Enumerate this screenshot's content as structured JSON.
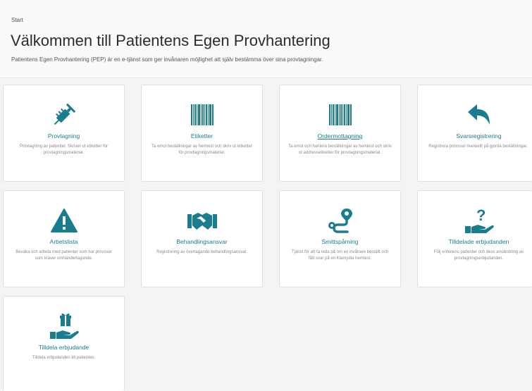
{
  "header": {
    "breadcrumb": "Start",
    "title": "Välkommen till Patientens Egen Provhantering",
    "subtitle": "Patientens Egen Provhantering (PEP) är en e-tjänst som ger invånaren möjlighet att själv bestämma över sina provtagningar."
  },
  "accent_color": "#1a7c8f",
  "cards": [
    {
      "title": "Provtagning",
      "icon": "syringe-icon",
      "desc": "Provtagning av patienter. Skriver ut etiketter för provtagningsmaterial."
    },
    {
      "title": "Etiketter",
      "icon": "barcode-icon",
      "desc": "Ta emot beställningar av hemtest och skriv ut etiketter för provtagningsmaterial."
    },
    {
      "title": "Ordermottagning",
      "icon": "barcode-icon",
      "desc": "Ta emot och hantera beställningar av hemtest och skriv ut addressetiketter för provtagningsmaterial."
    },
    {
      "title": "Svarsregistrering",
      "icon": "reply-arrow-icon",
      "desc": "Registrera provsvar manuellt på gjorda beställningar."
    },
    {
      "title": "Arbetslista",
      "icon": "warning-icon",
      "desc": "Bevaka och arbeta med patienter som har provsvar som kräver omhändertagande."
    },
    {
      "title": "Behandlingsansvar",
      "icon": "handshake-icon",
      "desc": "Registrering av övertagande behandlingsansvar."
    },
    {
      "title": "Smittspårning",
      "icon": "route-icon",
      "desc": "Tjänst för att ta reda på om en invånare beställt och fått svar på en Klamydia hemtest."
    },
    {
      "title": "Tilldelade erbjudanden",
      "icon": "hand-question-icon",
      "desc": "Följ enhetens patienter och dess användning av provtagningserbjudanden."
    },
    {
      "title": "Tilldela erbjudande",
      "icon": "hand-gift-icon",
      "desc": "Tilldela erbjudanden till patienten."
    }
  ]
}
